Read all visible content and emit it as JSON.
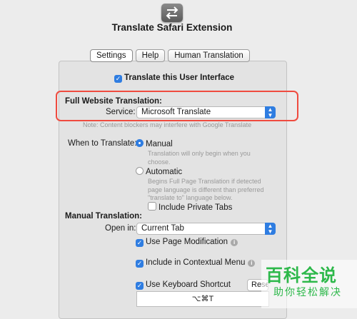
{
  "app": {
    "title": "Translate Safari Extension",
    "icon": "swap-arrows-icon"
  },
  "tabs": [
    {
      "label": "Settings",
      "active": true
    },
    {
      "label": "Help",
      "active": false
    },
    {
      "label": "Human Translation",
      "active": false
    }
  ],
  "settings": {
    "translate_ui_label": "Translate this User Interface",
    "full_site": {
      "heading": "Full Website Translation:",
      "service_label": "Service:",
      "service_value": "Microsoft Translate",
      "note": "Note: Content blockers may interfere with Google Translate"
    },
    "when": {
      "label": "When to Translate:",
      "manual_label": "Manual",
      "manual_desc": "Translation will only begin when you choose.",
      "automatic_label": "Automatic",
      "automatic_desc": "Begins Full Page Translation if detected page language is different than preferred \"translate to\" language below.",
      "private_tabs_label": "Include Private Tabs"
    },
    "manual": {
      "heading": "Manual Translation:",
      "open_in_label": "Open in:",
      "open_in_value": "Current Tab",
      "page_mod_label": "Use Page Modification",
      "context_menu_label": "Include in Contextual Menu",
      "keyboard_label": "Use Keyboard Shortcut",
      "reset_label": "Reset",
      "shortcut_value": "⌥⌘T"
    }
  },
  "watermark": {
    "line1": "百科全说",
    "line2": "助你轻松解决"
  },
  "colors": {
    "accent": "#2f7de1",
    "highlight": "#ef4b3f",
    "watermark": "#2db84a"
  }
}
